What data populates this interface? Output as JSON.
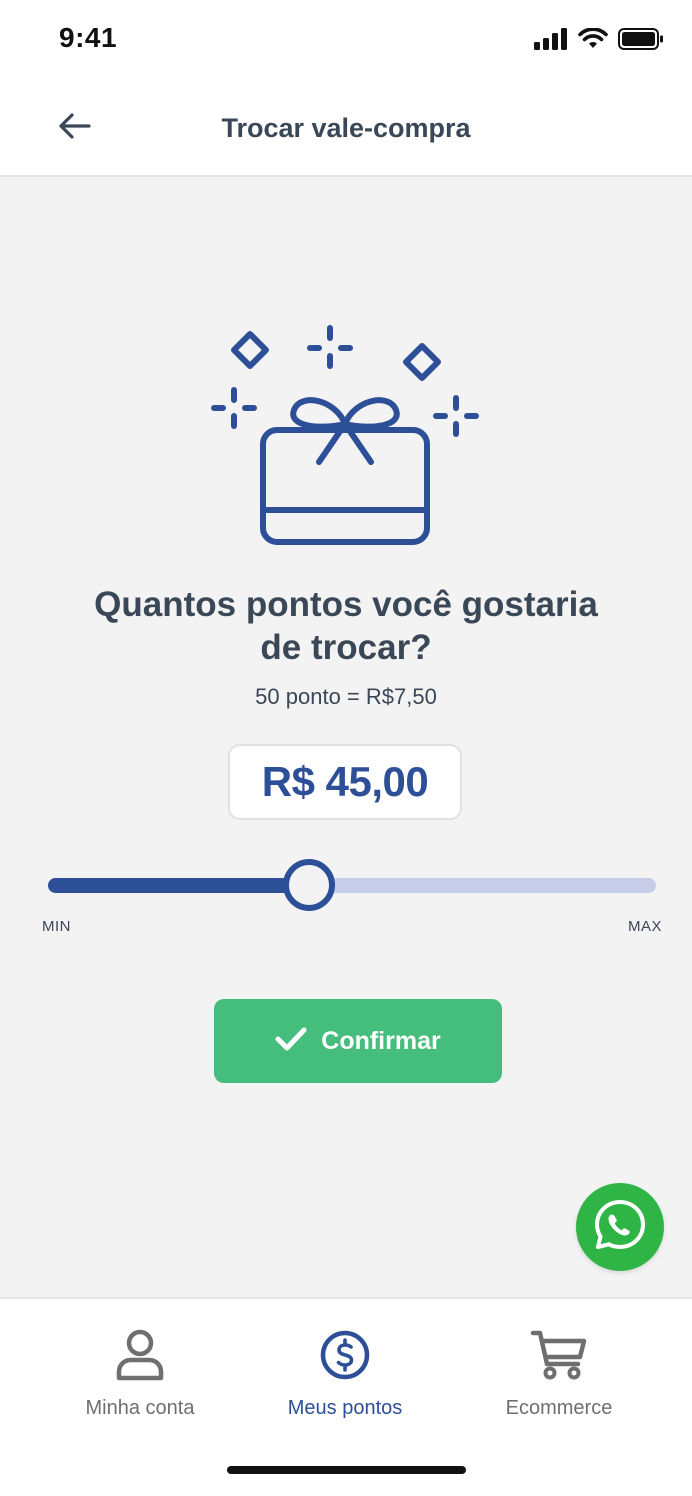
{
  "status_bar": {
    "time": "9:41"
  },
  "header": {
    "title": "Trocar vale-compra"
  },
  "question": "Quantos pontos você gostaria de trocar?",
  "rate_text": "50 ponto = R$7,50",
  "amount_text": "R$ 45,00",
  "slider": {
    "min_label": "MIN",
    "max_label": "MAX",
    "value_fraction": 0.43
  },
  "confirm_label": "Confirmar",
  "bottom_nav": [
    {
      "label": "Minha conta",
      "active": false
    },
    {
      "label": "Meus pontos",
      "active": true
    },
    {
      "label": "Ecommerce",
      "active": false
    }
  ],
  "colors": {
    "primary": "#2c4f98",
    "accent_green": "#45bd7c",
    "whatsapp": "#2fb545",
    "text": "#3a4756",
    "track": "#c7cde8",
    "background": "#f3f3f3"
  },
  "icons": {
    "back": "arrow-left-icon",
    "gift": "gift-card-icon",
    "confirm": "check-icon",
    "whatsapp": "whatsapp-icon",
    "account": "user-icon",
    "points": "dollar-circle-icon",
    "ecommerce": "cart-icon"
  }
}
